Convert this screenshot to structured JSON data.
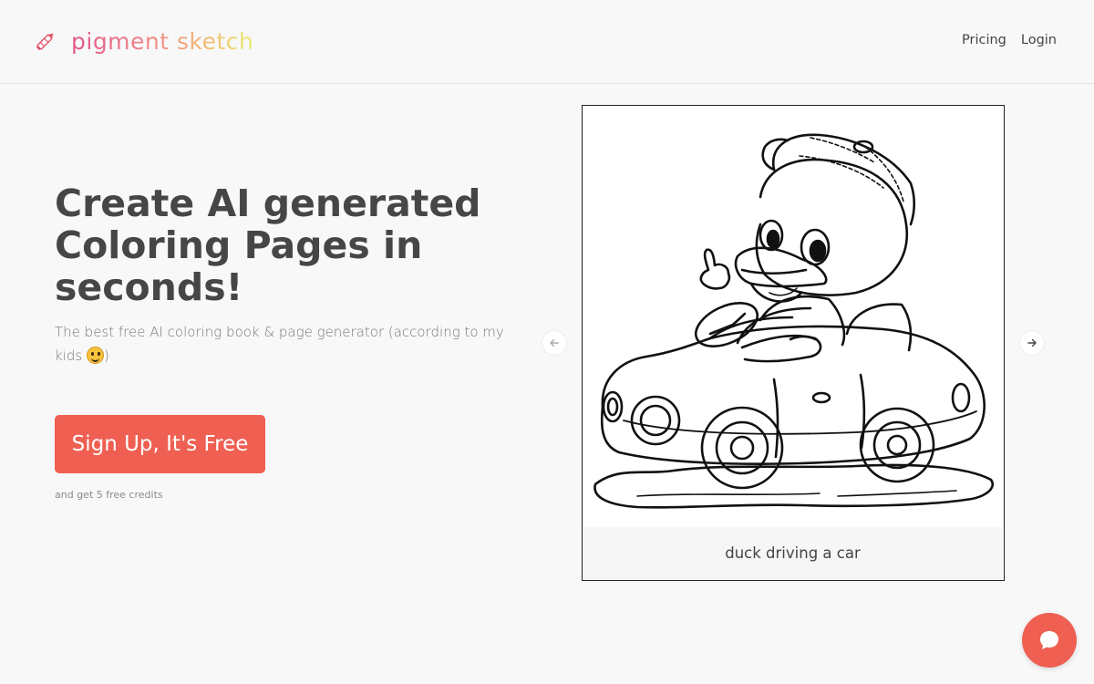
{
  "brand": {
    "name": "pigment sketch",
    "icon": "crayon-icon"
  },
  "nav": {
    "pricing": "Pricing",
    "login": "Login"
  },
  "hero": {
    "title": "Create AI generated Coloring Pages in seconds!",
    "subtitle": "The best free AI coloring book & page generator (according to my kids",
    "subtitle_close": ")",
    "emoji": "smiley-face-icon",
    "cta_label": "Sign Up, It's Free",
    "cta_note": "and get 5 free credits"
  },
  "carousel": {
    "caption": "duck driving a car",
    "prev_icon": "arrow-left-icon",
    "next_icon": "arrow-right-icon"
  },
  "chat": {
    "icon": "chat-bubble-icon"
  },
  "colors": {
    "accent": "#ef5f52",
    "text": "#464646",
    "background": "#f8f8f9"
  }
}
